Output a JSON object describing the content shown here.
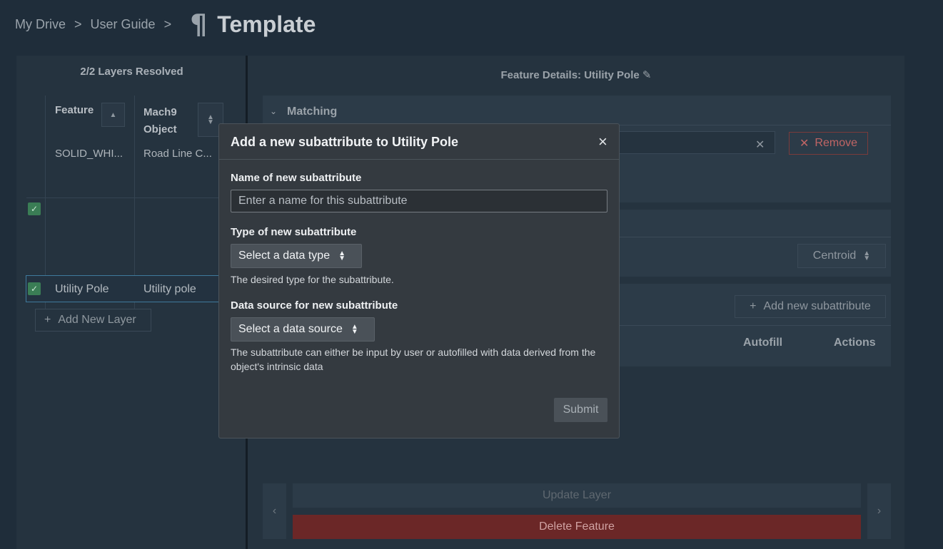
{
  "breadcrumb": {
    "items": [
      "My Drive",
      "User Guide"
    ],
    "separator": ">",
    "title": "Template",
    "title_icon": "pilcrow-icon"
  },
  "left_panel": {
    "heading": "2/2 Layers Resolved",
    "columns": [
      "Feature",
      "Mach9\nObject"
    ],
    "rows": [
      {
        "feature": "SOLID_WHI...",
        "object": "Road Line C...",
        "checked": true
      },
      {
        "feature": "Utility Pole",
        "object": "Utility pole",
        "checked": true
      }
    ],
    "add_layer_label": "Add New Layer"
  },
  "right_panel": {
    "heading": "Feature Details: Utility Pole",
    "matching_label": "Matching",
    "remove_label": "Remove",
    "centroid_label": "Centroid",
    "add_subattribute_label": "Add new subattribute",
    "columns": {
      "autofill": "Autofill",
      "actions": "Actions"
    },
    "update_label": "Update Layer",
    "delete_label": "Delete Feature"
  },
  "modal": {
    "title": "Add a new subattribute to Utility Pole",
    "close_label": "×",
    "name_label": "Name of new subattribute",
    "name_placeholder": "Enter a name for this subattribute",
    "type_label": "Type of new subattribute",
    "type_select": "Select a data type",
    "type_hint": "The desired type for the subattribute.",
    "source_label": "Data source for new subattribute",
    "source_select": "Select a data source",
    "source_hint": "The subattribute can either be input by user or autofilled with data derived from the object's intrinsic data",
    "submit_label": "Submit"
  },
  "colors": {
    "background": "#1f2d3a",
    "modal": "#343a40",
    "check_green": "#3a7d55",
    "delete_red": "#6b2727",
    "remove_red": "#c06565"
  }
}
